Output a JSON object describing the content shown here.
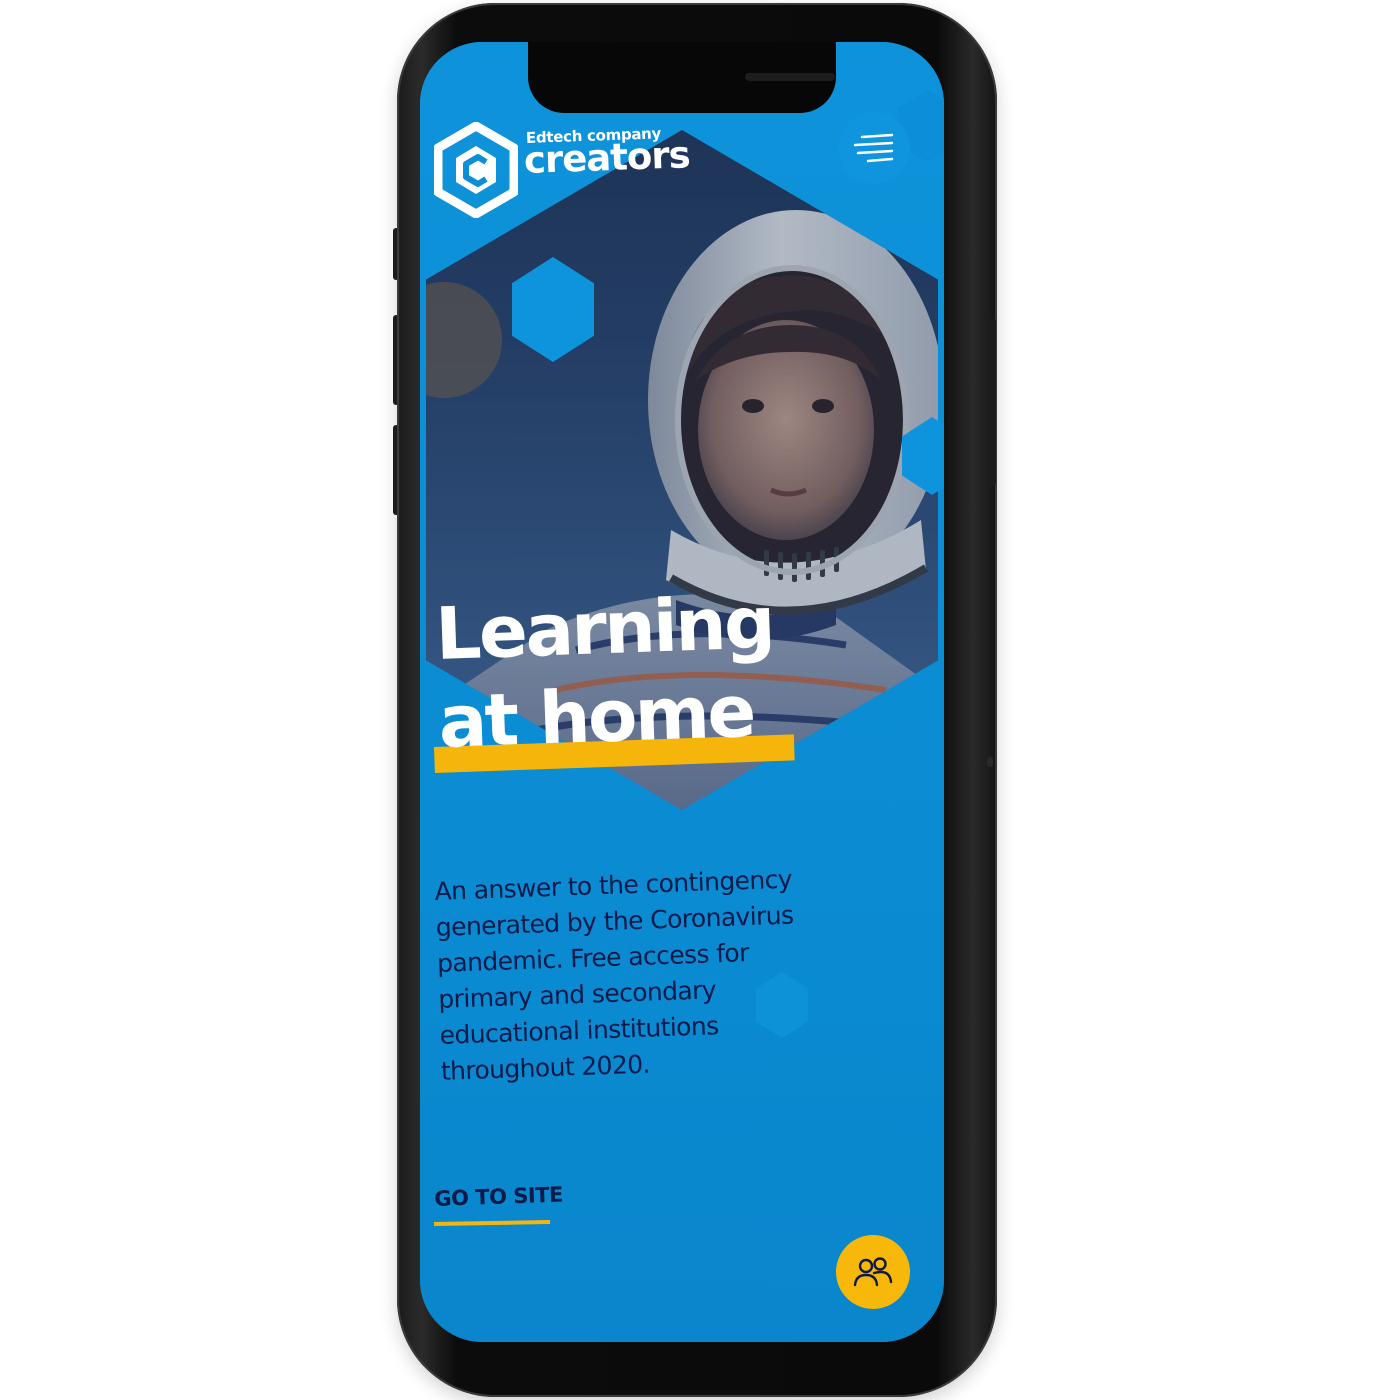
{
  "header": {
    "brand_tagline": "Edtech company",
    "brand_name": "creators",
    "logo_icon": "hexagon-c-logo-icon",
    "menu_icon": "hamburger-menu-icon"
  },
  "hero": {
    "headline_line1": "Learning",
    "headline_line2": "at home",
    "image_subject": "child-in-astronaut-helmet"
  },
  "body": {
    "lines": [
      "An answer to the contingency",
      "generated by the Coronavirus",
      "pandemic. Free access for",
      "primary and secondary",
      "educational institutions",
      "throughout 2020."
    ]
  },
  "cta": {
    "label": "GO TO SITE"
  },
  "fab": {
    "icon": "users-icon"
  },
  "colors": {
    "primary_blue": "#0d8fd6",
    "accent_yellow": "#f6b50b",
    "text_navy": "#0d1a4a",
    "text_white": "#ffffff",
    "phone_frame": "#0a0a0a"
  }
}
